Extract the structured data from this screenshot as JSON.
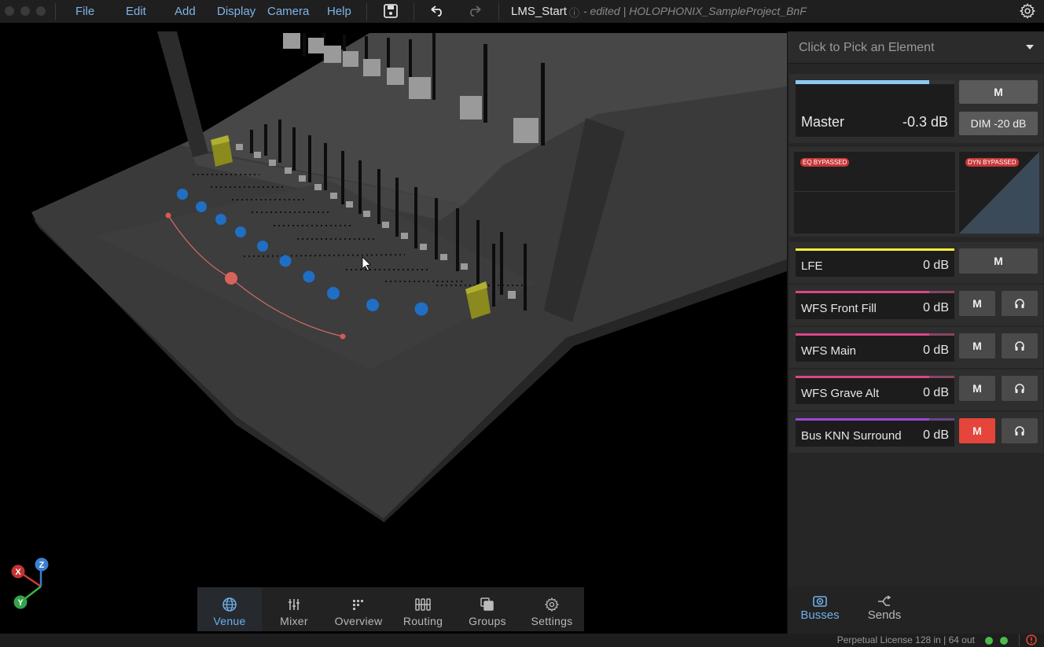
{
  "menu": {
    "file": "File",
    "edit": "Edit",
    "add": "Add",
    "display": "Display",
    "camera": "Camera",
    "help": "Help"
  },
  "document": {
    "title": "LMS_Start",
    "subtitle": "- edited | HOLOPHONIX_SampleProject_BnF"
  },
  "picker": {
    "placeholder": "Click to Pick an Element"
  },
  "master": {
    "label": "Master",
    "value": "-0.3 dB",
    "meter_level": 0.84,
    "mute_label": "M",
    "dim_label": "DIM -20 dB"
  },
  "eq": {
    "eq_badge": "EQ BYPASSED",
    "dyn_badge": "DYN BYPASSED"
  },
  "busses": [
    {
      "name": "LFE",
      "value": "0 dB",
      "color": "#f5f03a",
      "level": 1.0,
      "mute_label": "M",
      "muted": false,
      "has_solo": false
    },
    {
      "name": "WFS Front Fill",
      "value": "0 dB",
      "color": "#d9468a",
      "level": 0.84,
      "mute_label": "M",
      "muted": false,
      "has_solo": true
    },
    {
      "name": "WFS Main",
      "value": "0 dB",
      "color": "#d9468a",
      "level": 0.84,
      "mute_label": "M",
      "muted": false,
      "has_solo": true
    },
    {
      "name": "WFS Grave Alt",
      "value": "0 dB",
      "color": "#d9468a",
      "level": 0.84,
      "mute_label": "M",
      "muted": false,
      "has_solo": true
    },
    {
      "name": "Bus KNN Surround",
      "value": "0 dB",
      "color": "#9b48d6",
      "level": 0.84,
      "mute_label": "M",
      "muted": true,
      "has_solo": true
    }
  ],
  "bottom_tabs": [
    {
      "label": "Venue",
      "icon": "globe-icon",
      "active": true
    },
    {
      "label": "Mixer",
      "icon": "sliders-icon",
      "active": false
    },
    {
      "label": "Overview",
      "icon": "overview-icon",
      "active": false
    },
    {
      "label": "Routing",
      "icon": "routing-icon",
      "active": false
    },
    {
      "label": "Groups",
      "icon": "groups-icon",
      "active": false
    },
    {
      "label": "Settings",
      "icon": "gear-icon",
      "active": false
    }
  ],
  "panel_tabs": [
    {
      "label": "Busses",
      "icon": "speaker-icon",
      "active": true
    },
    {
      "label": "Sends",
      "icon": "sends-icon",
      "active": false
    }
  ],
  "axes": {
    "x": "X",
    "y": "Y",
    "z": "Z"
  },
  "status": {
    "license": "Perpetual License 128 in | 64 out"
  },
  "colors": {
    "accent": "#6fb0ea",
    "mute_active": "#e5453a",
    "status_ok": "#4cba4c",
    "status_error": "#e5453a"
  }
}
